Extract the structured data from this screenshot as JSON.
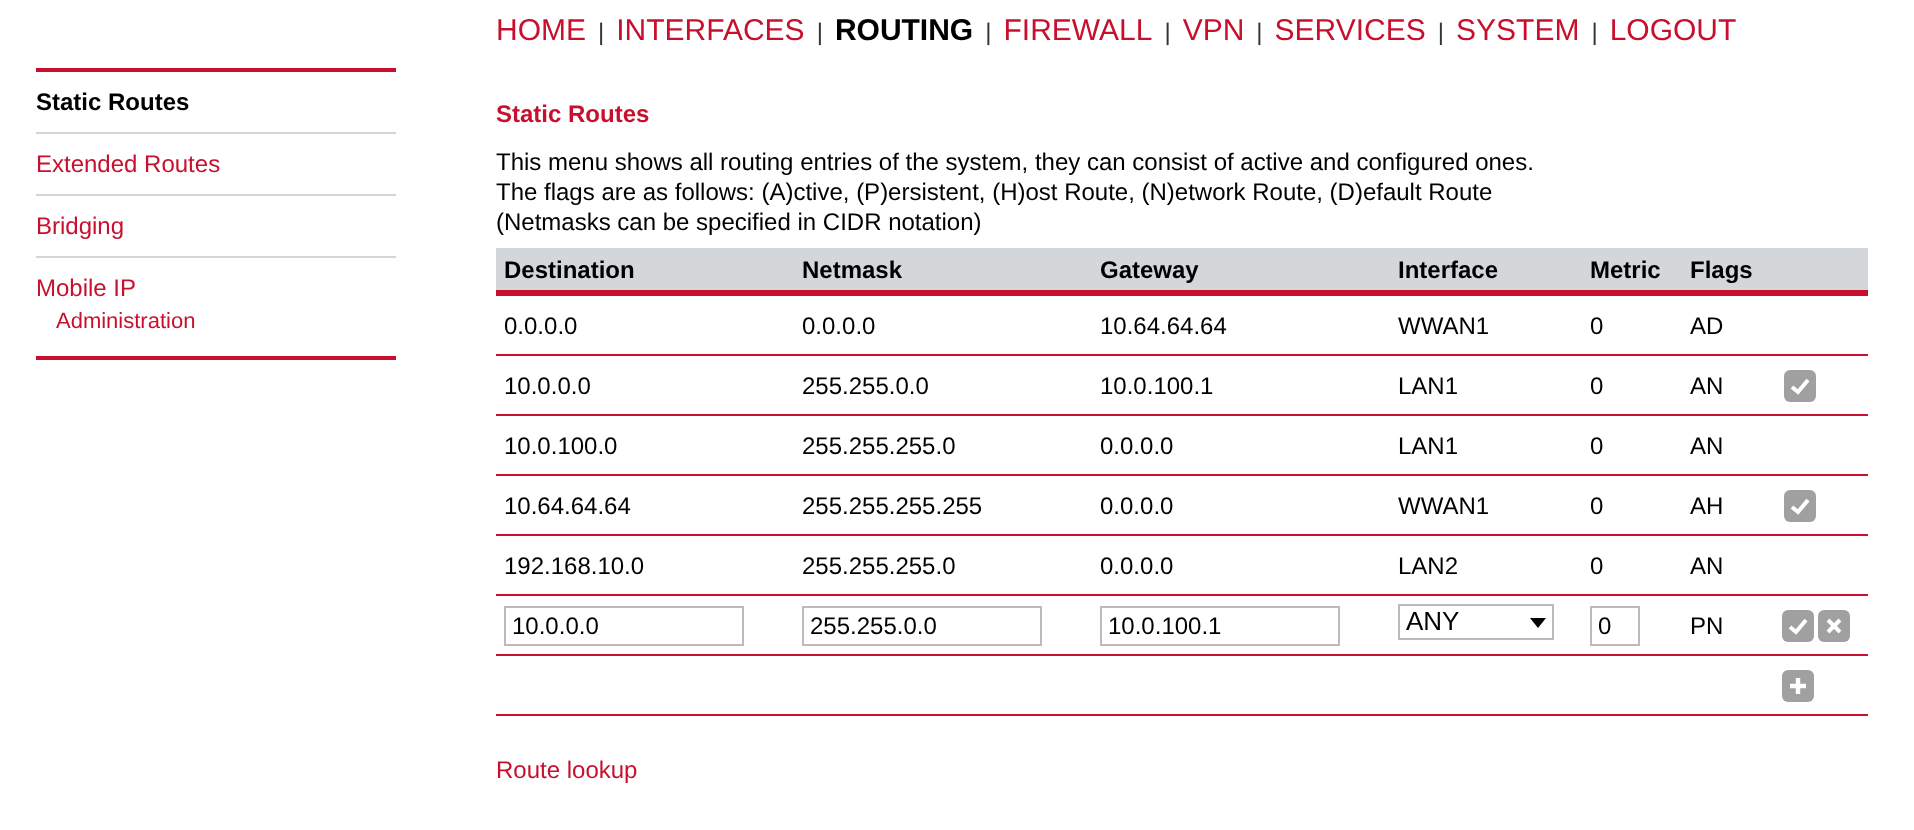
{
  "nav": [
    {
      "label": "HOME",
      "selected": false
    },
    {
      "label": "INTERFACES",
      "selected": false
    },
    {
      "label": "ROUTING",
      "selected": true
    },
    {
      "label": "FIREWALL",
      "selected": false
    },
    {
      "label": "VPN",
      "selected": false
    },
    {
      "label": "SERVICES",
      "selected": false
    },
    {
      "label": "SYSTEM",
      "selected": false
    },
    {
      "label": "LOGOUT",
      "selected": false
    }
  ],
  "nav_separator": "|",
  "sidebar": {
    "items": [
      {
        "label": "Static Routes",
        "selected": true
      },
      {
        "label": "Extended Routes",
        "selected": false
      },
      {
        "label": "Bridging",
        "selected": false
      },
      {
        "label": "Mobile IP",
        "selected": false,
        "children": [
          {
            "label": "Administration",
            "selected": false
          }
        ]
      }
    ]
  },
  "section_title": "Static Routes",
  "description": [
    "This menu shows all routing entries of the system, they can consist of active and configured ones.",
    "The flags are as follows: (A)ctive, (P)ersistent, (H)ost Route, (N)etwork Route, (D)efault Route",
    "(Netmasks can be specified in CIDR notation)"
  ],
  "table": {
    "columns": [
      "Destination",
      "Netmask",
      "Gateway",
      "Interface",
      "Metric",
      "Flags"
    ],
    "rows": [
      {
        "kind": "route",
        "cells": [
          "0.0.0.0",
          "0.0.0.0",
          "10.64.64.64",
          "WWAN1",
          "0",
          "AD"
        ],
        "editable": false
      },
      {
        "kind": "route",
        "cells": [
          "10.0.0.0",
          "255.255.0.0",
          "10.0.100.1",
          "LAN1",
          "0",
          "AN"
        ],
        "editable": true
      },
      {
        "kind": "route",
        "cells": [
          "10.0.100.0",
          "255.255.255.0",
          "0.0.0.0",
          "LAN1",
          "0",
          "AN"
        ],
        "editable": false
      },
      {
        "kind": "route",
        "cells": [
          "10.64.64.64",
          "255.255.255.255",
          "0.0.0.0",
          "WWAN1",
          "0",
          "AH"
        ],
        "editable": true
      },
      {
        "kind": "route",
        "cells": [
          "192.168.10.0",
          "255.255.255.0",
          "0.0.0.0",
          "LAN2",
          "0",
          "AN"
        ],
        "editable": false
      },
      {
        "kind": "edit",
        "destination": "10.0.0.0",
        "netmask": "255.255.0.0",
        "gateway": "10.0.100.1",
        "interface": "ANY",
        "metric": "0",
        "flags": "PN"
      },
      {
        "kind": "add"
      }
    ]
  },
  "route_lookup_link": "Route lookup"
}
